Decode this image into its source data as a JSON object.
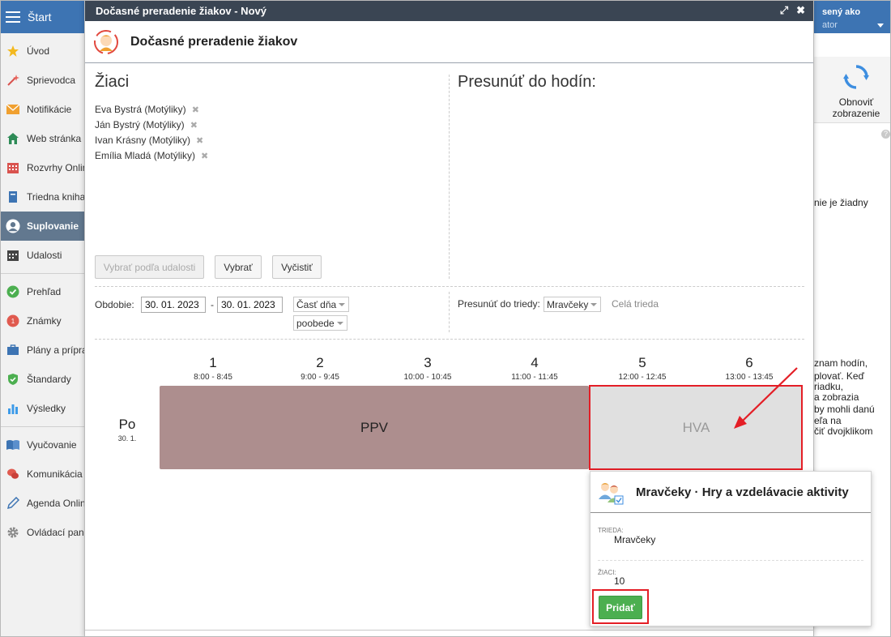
{
  "sidebar": {
    "start_label": "Štart",
    "items": [
      {
        "label": "Úvod",
        "icon": "star-icon"
      },
      {
        "label": "Sprievodca",
        "icon": "wand-icon"
      },
      {
        "label": "Notifikácie",
        "icon": "envelope-icon"
      },
      {
        "label": "Web stránka",
        "icon": "house-icon"
      },
      {
        "label": "Rozvrhy Onlin",
        "icon": "calendar-grid-icon"
      },
      {
        "label": "Triedna kniha",
        "icon": "book-icon"
      },
      {
        "label": "Suplovanie",
        "icon": "person-icon"
      },
      {
        "label": "Udalosti",
        "icon": "calendar-icon"
      },
      {
        "label": "Prehľad",
        "icon": "check-circle-icon"
      },
      {
        "label": "Známky",
        "icon": "grade-icon"
      },
      {
        "label": "Plány a prípra",
        "icon": "briefcase-icon"
      },
      {
        "label": "Štandardy",
        "icon": "shield-check-icon"
      },
      {
        "label": "Výsledky",
        "icon": "bar-chart-icon"
      },
      {
        "label": "Vyučovanie",
        "icon": "open-book-icon"
      },
      {
        "label": "Komunikácia",
        "icon": "chat-icon"
      },
      {
        "label": "Agenda Onlin",
        "icon": "pen-icon"
      },
      {
        "label": "Ovládací pan",
        "icon": "gear-icon"
      }
    ]
  },
  "background": {
    "user_line1": "sený ako",
    "user_line2": "ator",
    "refresh_label_1": "Obnoviť",
    "refresh_label_2": "zobrazenie",
    "help": "?",
    "text_1": "nie je žiadny",
    "text_lines": [
      "znam hodín,",
      "plovať. Keď",
      "riadku,",
      "a zobrazia",
      "by mohli danú",
      "eľa na",
      "čiť dvojklikom"
    ]
  },
  "modal": {
    "window_title": "Dočasné preradenie žiakov - Nový",
    "header_title": "Dočasné preradenie žiakov",
    "students_heading": "Žiaci",
    "students": [
      "Eva Bystrá (Motýliky)",
      "Ján Bystrý (Motýliky)",
      "Ivan Krásny (Motýliky)",
      "Emília Mladá (Motýliky)"
    ],
    "move_heading": "Presunúť do hodín:",
    "btn_by_event": "Vybrať podľa udalosti",
    "btn_select": "Vybrať",
    "btn_clear": "Vyčistiť",
    "period_label": "Obdobie:",
    "date_from": "30. 01. 2023",
    "date_sep": "-",
    "date_to": "30. 01. 2023",
    "part_of_day": "Časť dňa",
    "part_value": "poobede",
    "move_to_class_label": "Presunúť do triedy:",
    "move_to_class_value": "Mravčeky",
    "whole_class": "Celá trieda"
  },
  "timetable": {
    "periods": [
      {
        "num": "1",
        "time": "8:00 - 8:45"
      },
      {
        "num": "2",
        "time": "9:00 - 9:45"
      },
      {
        "num": "3",
        "time": "10:00 - 10:45"
      },
      {
        "num": "4",
        "time": "11:00 - 11:45"
      },
      {
        "num": "5",
        "time": "12:00 - 12:45"
      },
      {
        "num": "6",
        "time": "13:00 - 13:45"
      }
    ],
    "day_name": "Po",
    "day_date": "30. 1.",
    "lessons": [
      {
        "label": "PPV",
        "color": "#ad8e8e"
      },
      {
        "label": "HVA",
        "color": "#e0e0e0"
      }
    ]
  },
  "popup": {
    "title": "Mravčeky · Hry a vzdelávacie aktivity",
    "class_label": "TRIEDA:",
    "class_value": "Mravčeky",
    "students_label": "ŽIACI:",
    "students_value": "10",
    "add_button": "Pridať"
  },
  "colors": {
    "topbar": "#3d74b3",
    "modal_titlebar": "#3a4553",
    "active_nav": "#62788f",
    "highlight": "#e41e26",
    "add_button": "#4caf50"
  }
}
